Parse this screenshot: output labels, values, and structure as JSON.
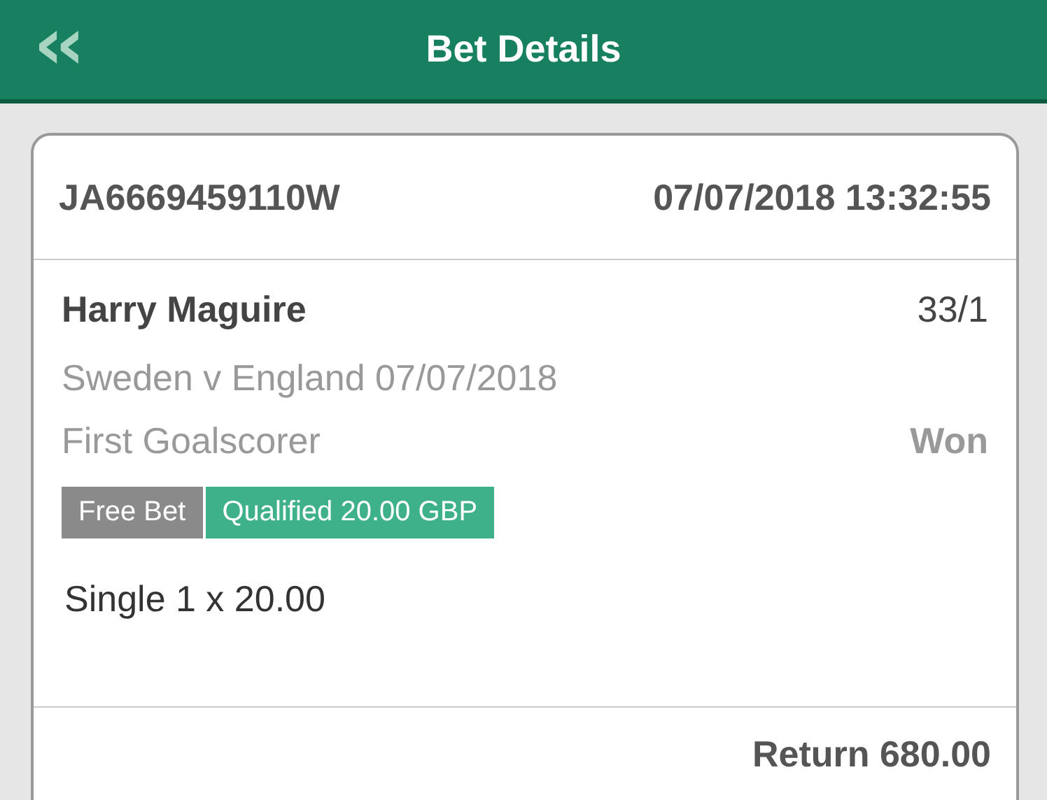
{
  "header": {
    "back": "‹‹",
    "title": "Bet Details"
  },
  "bet": {
    "reference": "JA6669459110W",
    "datetime": "07/07/2018 13:32:55",
    "selection": "Harry Maguire",
    "odds": "33/1",
    "event": "Sweden v England 07/07/2018",
    "market": "First Goalscorer",
    "result": "Won",
    "tags": [
      {
        "text": "Free Bet",
        "color": "#8a8a8a"
      },
      {
        "text": "Qualified 20.00 GBP",
        "color": "#3eb08a"
      }
    ],
    "stake": "Single 1 x 20.00",
    "return": "Return 680.00"
  }
}
